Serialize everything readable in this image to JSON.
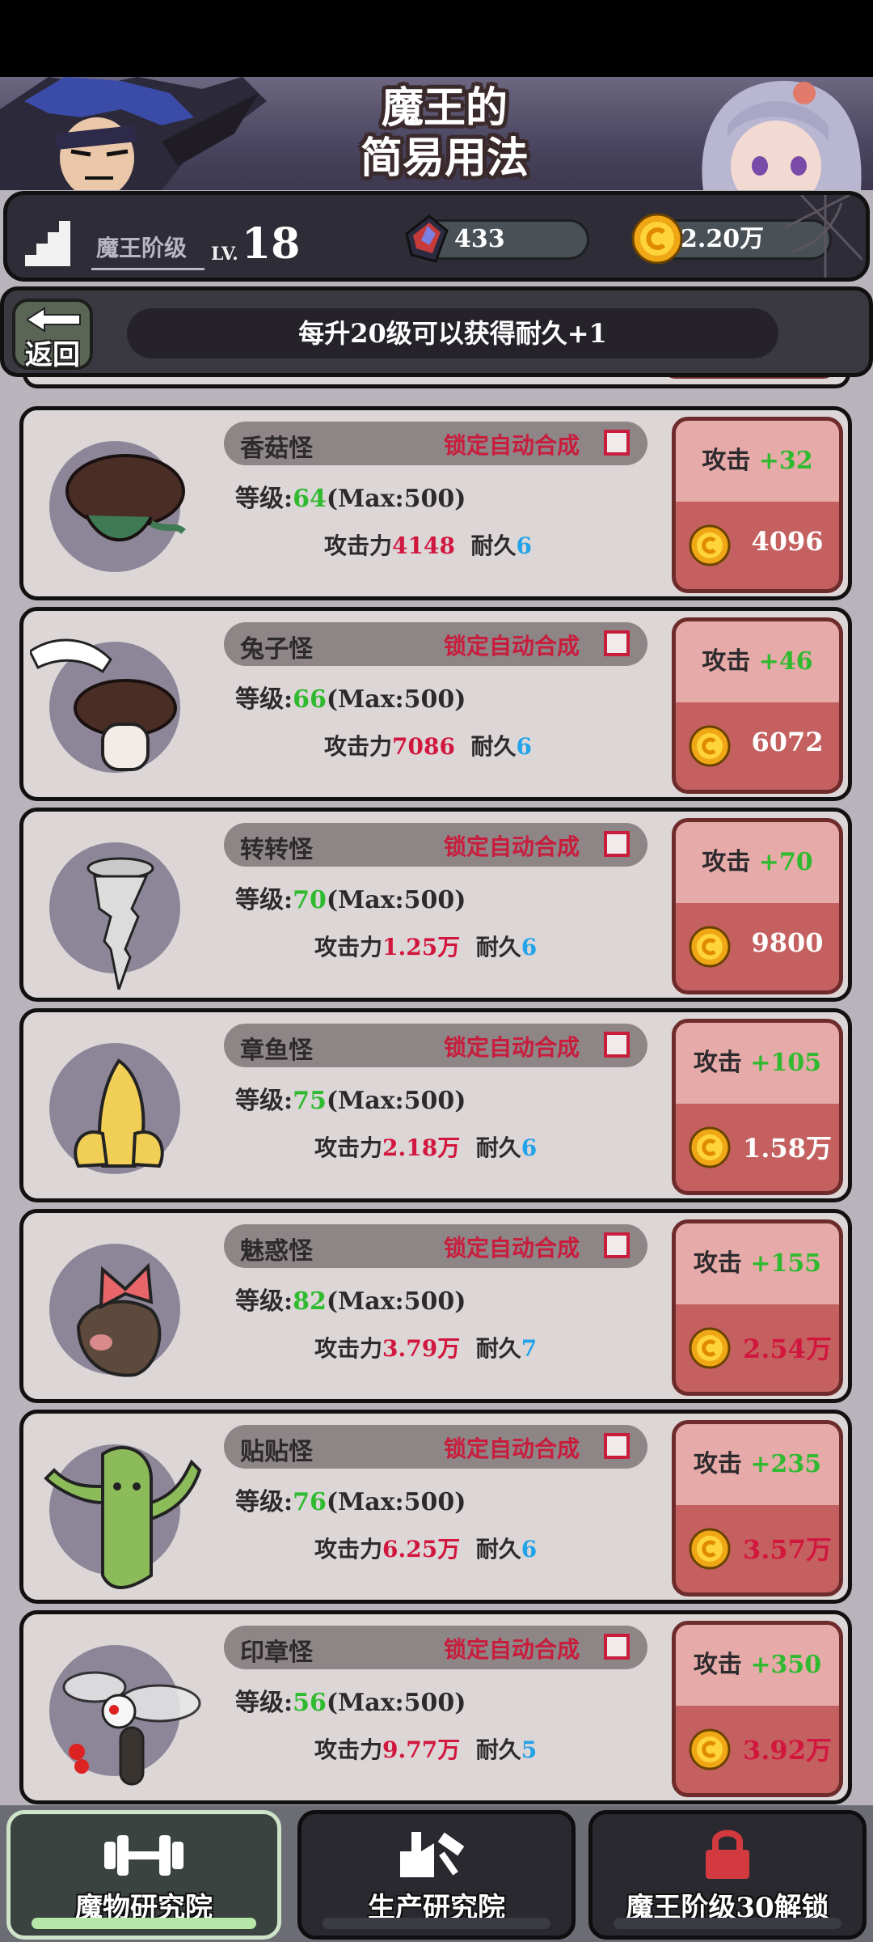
{
  "banner": {
    "title_line1": "魔王的",
    "title_line2": "简易用法"
  },
  "stats": {
    "rank_label": "魔王阶级",
    "lv_prefix": "LV.",
    "level": "18",
    "gems": "433",
    "coins": "2.20万"
  },
  "notice": {
    "back_label": "返回",
    "message": "每升20级可以获得耐久+1"
  },
  "labels": {
    "level_prefix": "等级:",
    "max": "(Max:500)",
    "attack_label": "攻击力",
    "durability_label": "耐久",
    "upgrade_prefix": "攻击",
    "lock_auto": "锁定自动合成"
  },
  "monsters": [
    {
      "name": "香菇怪",
      "level": "64",
      "attack": "4148",
      "durability": "6",
      "gain": "+32",
      "cost": "4096",
      "cost_affordable": true
    },
    {
      "name": "兔子怪",
      "level": "66",
      "attack": "7086",
      "durability": "6",
      "gain": "+46",
      "cost": "6072",
      "cost_affordable": true
    },
    {
      "name": "转转怪",
      "level": "70",
      "attack": "1.25万",
      "durability": "6",
      "gain": "+70",
      "cost": "9800",
      "cost_affordable": true
    },
    {
      "name": "章鱼怪",
      "level": "75",
      "attack": "2.18万",
      "durability": "6",
      "gain": "+105",
      "cost": "1.58万",
      "cost_affordable": true
    },
    {
      "name": "魅惑怪",
      "level": "82",
      "attack": "3.79万",
      "durability": "7",
      "gain": "+155",
      "cost": "2.54万",
      "cost_affordable": false
    },
    {
      "name": "贴贴怪",
      "level": "76",
      "attack": "6.25万",
      "durability": "6",
      "gain": "+235",
      "cost": "3.57万",
      "cost_affordable": false
    },
    {
      "name": "印章怪",
      "level": "56",
      "attack": "9.77万",
      "durability": "5",
      "gain": "+350",
      "cost": "3.92万",
      "cost_affordable": false
    }
  ],
  "tabs": [
    {
      "label": "魔物研究院",
      "icon": "dumbbell-icon",
      "active": true
    },
    {
      "label": "生产研究院",
      "icon": "factory-hammer-icon",
      "active": false
    },
    {
      "label": "魔王阶级30解锁",
      "icon": "lock-icon",
      "active": false
    }
  ],
  "colors": {
    "accent_green": "#2fba2f",
    "accent_red": "#d2173f",
    "accent_blue": "#23a3e8",
    "button_red": "#c4605f"
  }
}
